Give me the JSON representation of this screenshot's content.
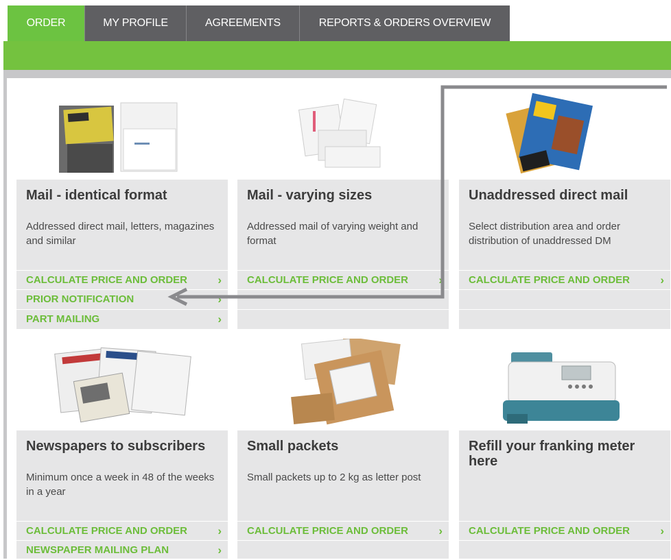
{
  "tabs": [
    "ORDER",
    "MY PROFILE",
    "AGREEMENTS",
    "REPORTS & ORDERS OVERVIEW"
  ],
  "cards": [
    {
      "title": "Mail - identical format",
      "desc": "Addressed direct mail, letters, magazines and similar",
      "links": [
        "CALCULATE PRICE AND ORDER",
        "PRIOR NOTIFICATION",
        "PART MAILING"
      ],
      "image": "stack-of-letters-image"
    },
    {
      "title": "Mail - varying sizes",
      "desc": "Addressed mail of varying weight and format",
      "links": [
        "CALCULATE PRICE AND ORDER"
      ],
      "image": "envelopes-image"
    },
    {
      "title": "Unaddressed direct mail",
      "desc": "Select distribution area and order distribution of unaddressed DM",
      "links": [
        "CALCULATE PRICE AND ORDER"
      ],
      "image": "catalogues-image"
    },
    {
      "title": "Newspapers to subscribers",
      "desc": "Minimum once a week in 48 of the weeks in a year",
      "links": [
        "CALCULATE PRICE AND ORDER",
        "NEWSPAPER MAILING PLAN"
      ],
      "image": "newspapers-image"
    },
    {
      "title": "Small packets",
      "desc": "Small packets up to 2 kg as letter post",
      "links": [
        "CALCULATE PRICE AND ORDER"
      ],
      "image": "small-packets-image"
    },
    {
      "title": "Refill your franking meter here",
      "desc": "",
      "links": [
        "CALCULATE PRICE AND ORDER"
      ],
      "image": "franking-meter-image"
    }
  ],
  "colors": {
    "accent_green": "#6cbd3a",
    "tab_dark": "#5f5f62",
    "panel_grey": "#e6e6e7",
    "arrow_grey": "#8a8a8d"
  }
}
